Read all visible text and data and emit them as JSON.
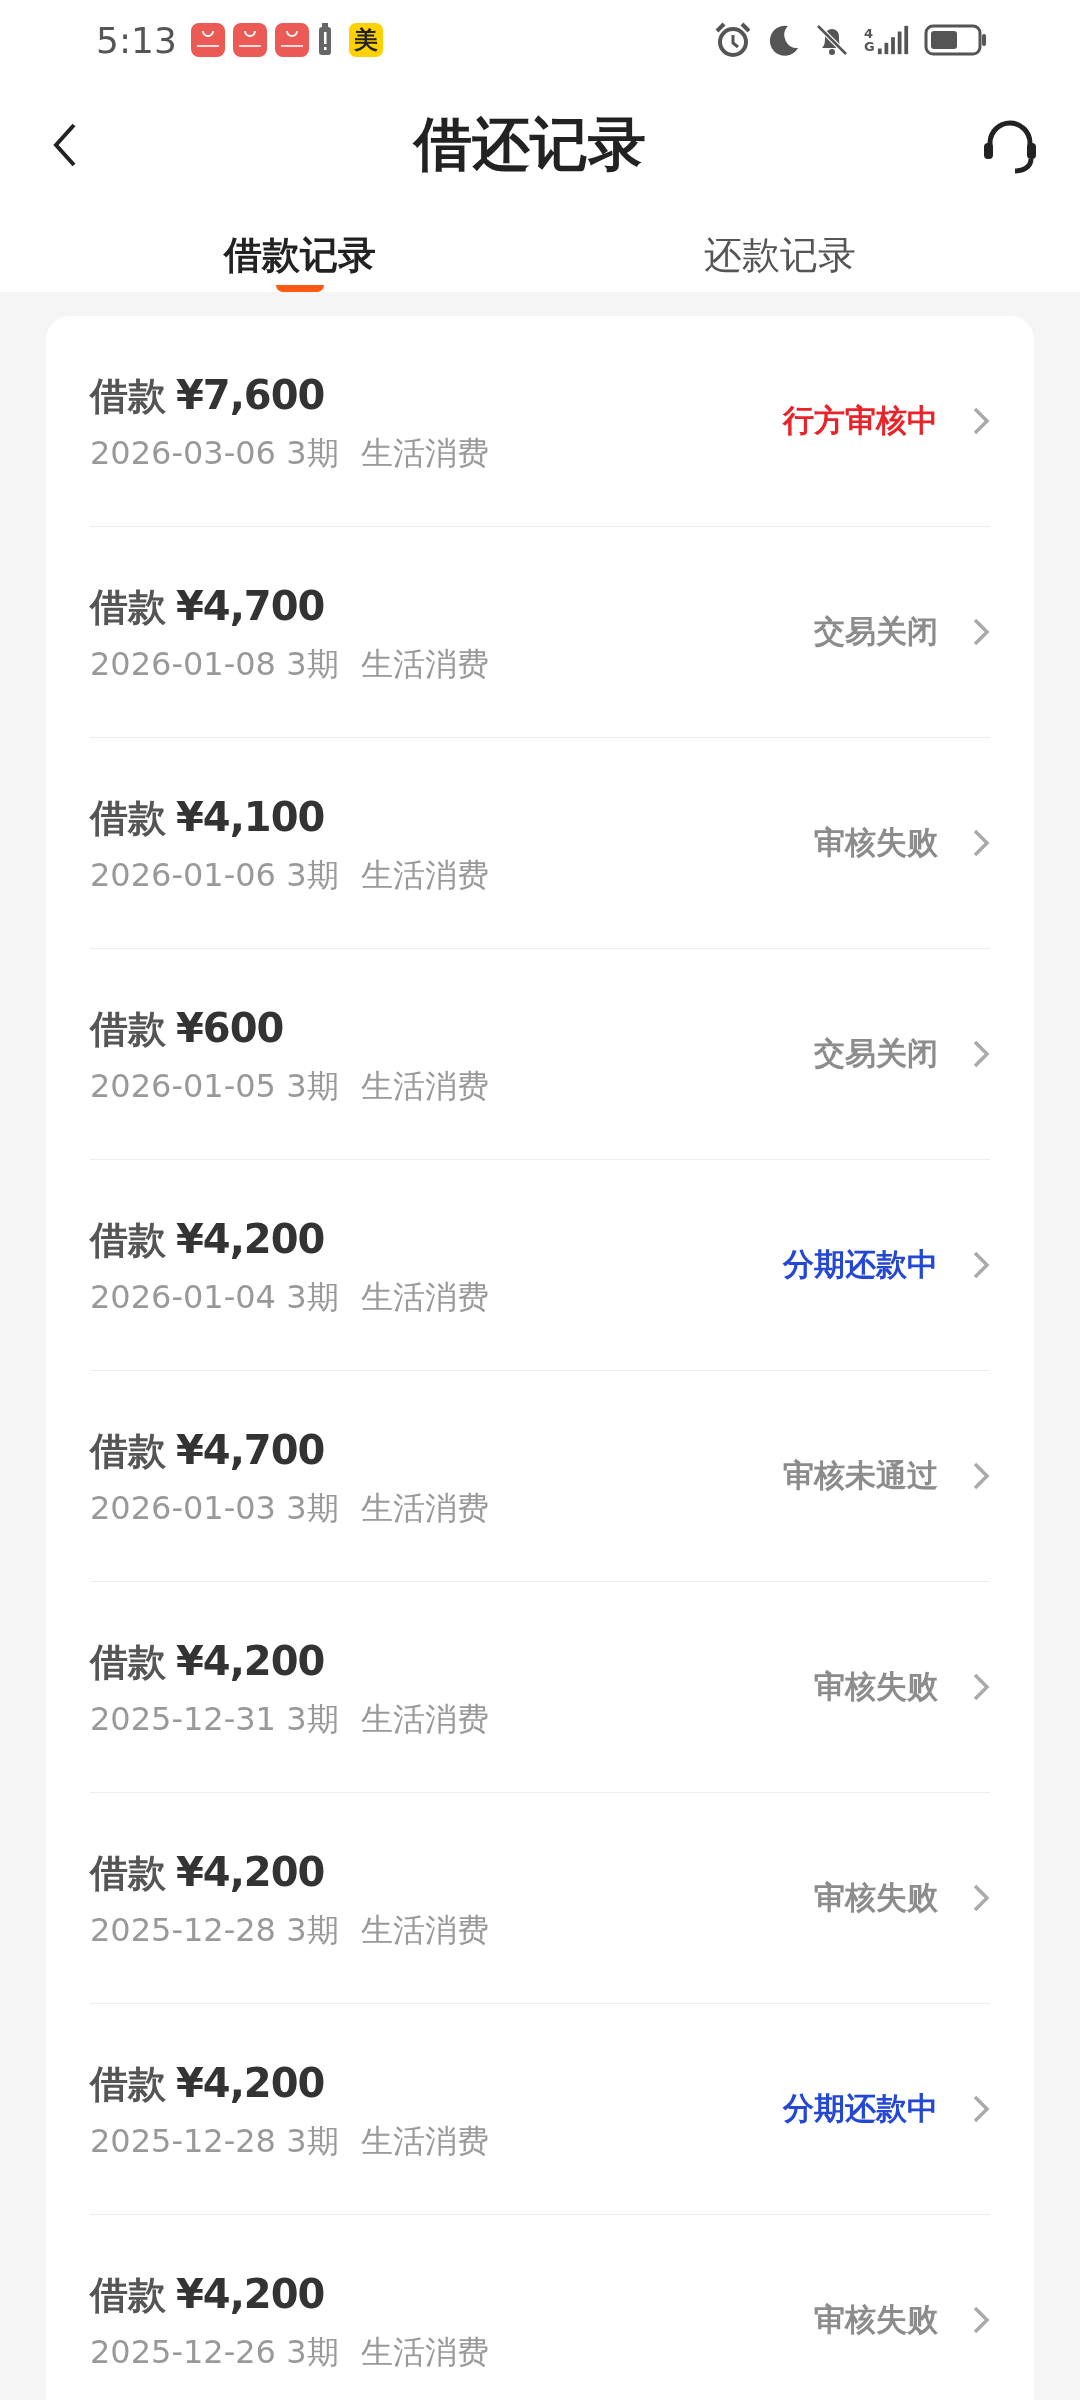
{
  "status_bar": {
    "time": "5:13",
    "meituan_badge": "美",
    "network": "4G"
  },
  "header": {
    "title": "借还记录"
  },
  "tabs": [
    {
      "label": "借款记录",
      "selected": true
    },
    {
      "label": "还款记录",
      "selected": false
    }
  ],
  "records": [
    {
      "label": "借款",
      "amount": "¥7,600",
      "date": "2026-03-06 3期",
      "purpose": "生活消费",
      "status": "行方审核中",
      "color": "#e8242a"
    },
    {
      "label": "借款",
      "amount": "¥4,700",
      "date": "2026-01-08 3期",
      "purpose": "生活消费",
      "status": "交易关闭",
      "color": "#8c8c8c"
    },
    {
      "label": "借款",
      "amount": "¥4,100",
      "date": "2026-01-06 3期",
      "purpose": "生活消费",
      "status": "审核失败",
      "color": "#8c8c8c"
    },
    {
      "label": "借款",
      "amount": "¥600",
      "date": "2026-01-05 3期",
      "purpose": "生活消费",
      "status": "交易关闭",
      "color": "#8c8c8c"
    },
    {
      "label": "借款",
      "amount": "¥4,200",
      "date": "2026-01-04 3期",
      "purpose": "生活消费",
      "status": "分期还款中",
      "color": "#2447d6"
    },
    {
      "label": "借款",
      "amount": "¥4,700",
      "date": "2026-01-03 3期",
      "purpose": "生活消费",
      "status": "审核未通过",
      "color": "#8c8c8c"
    },
    {
      "label": "借款",
      "amount": "¥4,200",
      "date": "2025-12-31 3期",
      "purpose": "生活消费",
      "status": "审核失败",
      "color": "#8c8c8c"
    },
    {
      "label": "借款",
      "amount": "¥4,200",
      "date": "2025-12-28 3期",
      "purpose": "生活消费",
      "status": "审核失败",
      "color": "#8c8c8c"
    },
    {
      "label": "借款",
      "amount": "¥4,200",
      "date": "2025-12-28 3期",
      "purpose": "生活消费",
      "status": "分期还款中",
      "color": "#2447d6"
    },
    {
      "label": "借款",
      "amount": "¥4,200",
      "date": "2025-12-26 3期",
      "purpose": "生活消费",
      "status": "审核失败",
      "color": "#8c8c8c"
    }
  ]
}
